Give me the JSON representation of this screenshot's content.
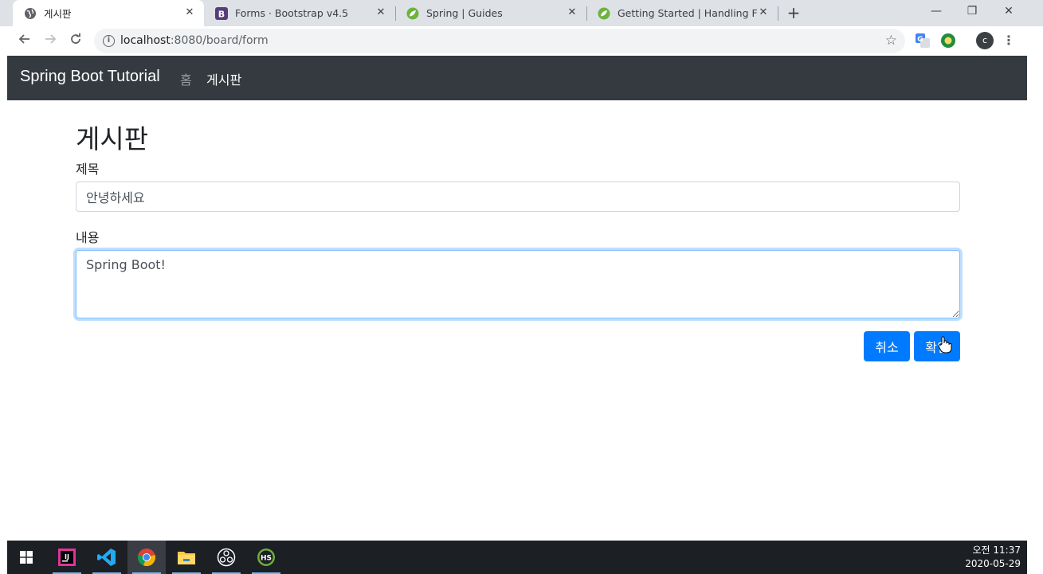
{
  "browser": {
    "tabs": [
      {
        "title": "게시판",
        "icon": "globe-icon",
        "active": true
      },
      {
        "title": "Forms · Bootstrap v4.5",
        "icon": "bootstrap-icon",
        "active": false
      },
      {
        "title": "Spring | Guides",
        "icon": "spring-leaf-icon",
        "active": false
      },
      {
        "title": "Getting Started | Handling Form",
        "icon": "spring-leaf-icon",
        "active": false
      }
    ],
    "close_glyph": "✕",
    "new_tab_glyph": "+",
    "window_controls": {
      "minimize": "—",
      "restore": "❐",
      "close": "✕"
    },
    "url_host": "localhost",
    "url_rest": ":8080/board/form",
    "profile_initial": "c"
  },
  "navbar": {
    "brand": "Spring Boot Tutorial",
    "links": [
      {
        "label": "홈",
        "active": false
      },
      {
        "label": "게시판",
        "active": true
      }
    ],
    "background": "#343a40"
  },
  "form": {
    "page_title": "게시판",
    "title_label": "제목",
    "title_value": "안녕하세요",
    "content_label": "내용",
    "content_value": "Spring Boot!",
    "cancel_label": "취소",
    "submit_label": "확인",
    "button_color": "#007bff"
  },
  "taskbar": {
    "apps": [
      "windows-start-icon",
      "intellij-icon",
      "vscode-icon",
      "chrome-icon",
      "file-explorer-icon",
      "obs-icon",
      "hs-icon"
    ],
    "clock_time": "오전 11:37",
    "clock_date": "2020-05-29"
  }
}
